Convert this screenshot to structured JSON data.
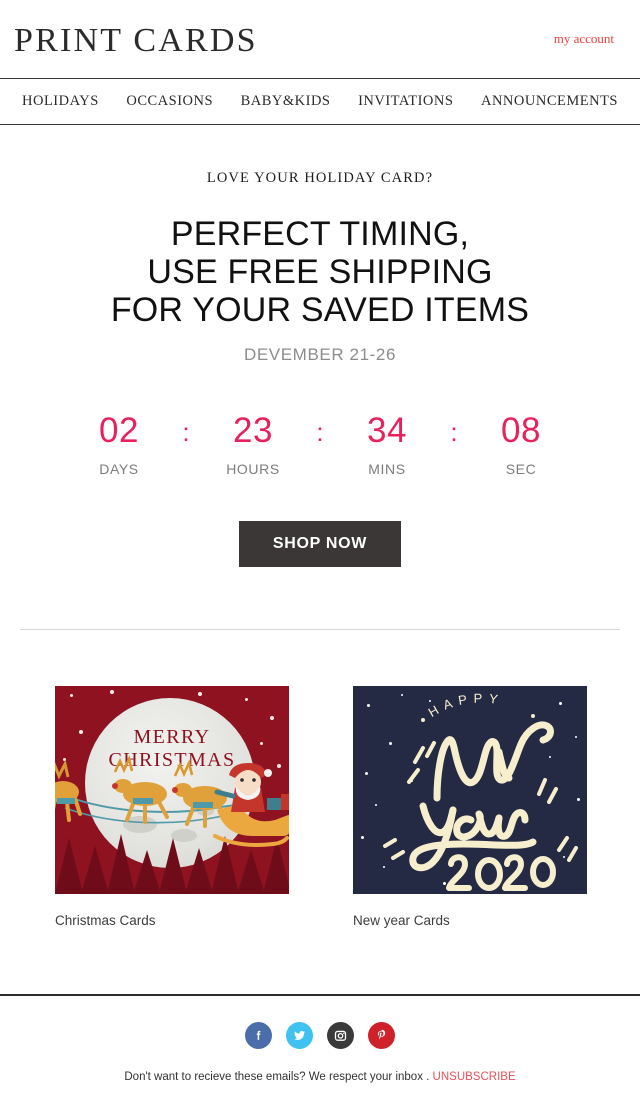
{
  "header": {
    "logo": "PRINT CARDS",
    "account_link": "my account"
  },
  "nav": {
    "items": [
      {
        "label": "HOLIDAYS"
      },
      {
        "label": "OCCASIONS"
      },
      {
        "label": "BABY&KIDS"
      },
      {
        "label": "INVITATIONS"
      },
      {
        "label": "ANNOUNCEMENTS"
      }
    ]
  },
  "hero": {
    "eyebrow": "LOVE YOUR HOLIDAY CARD?",
    "headline_line1": "PERFECT TIMING,",
    "headline_line2": "USE FREE SHIPPING",
    "headline_line3": "FOR YOUR SAVED ITEMS",
    "date_range": "DEVEMBER 21-26"
  },
  "countdown": {
    "separator": ":",
    "accent_color": "#e8215c",
    "units": [
      {
        "value": "02",
        "label": "DAYS"
      },
      {
        "value": "23",
        "label": "HOURS"
      },
      {
        "value": "34",
        "label": "MINS"
      },
      {
        "value": "08",
        "label": "SEC"
      }
    ]
  },
  "cta": {
    "label": "SHOP NOW",
    "background_color": "#3a3736",
    "text_color": "#ffffff"
  },
  "products": [
    {
      "caption": "Christmas Cards",
      "art": {
        "kind": "christmas-card",
        "background_color": "#8e1220",
        "text_line1": "MERRY",
        "text_line2": "CHRISTMAS",
        "text_color": "#8e1220",
        "moon_color": "#e8e8e4"
      }
    },
    {
      "caption": "New year Cards",
      "art": {
        "kind": "new-year-card",
        "background_color": "#252a44",
        "text_top": "HAPPY",
        "text_script1": "New",
        "text_script2": "Year",
        "text_year": "2020",
        "text_color": "#f6eecd"
      }
    }
  ],
  "footer": {
    "social": [
      {
        "name": "facebook",
        "glyph": "f",
        "color": "#4a6ea9"
      },
      {
        "name": "twitter",
        "glyph": "t",
        "color": "#3fc2f0"
      },
      {
        "name": "instagram",
        "glyph": "i",
        "color": "#3a3a3a"
      },
      {
        "name": "pinterest",
        "glyph": "p",
        "color": "#cf2129"
      }
    ],
    "unsubscribe_text": "Don't want to recieve these emails? We respect your inbox .",
    "unsubscribe_link": "UNSUBSCRIBE"
  }
}
